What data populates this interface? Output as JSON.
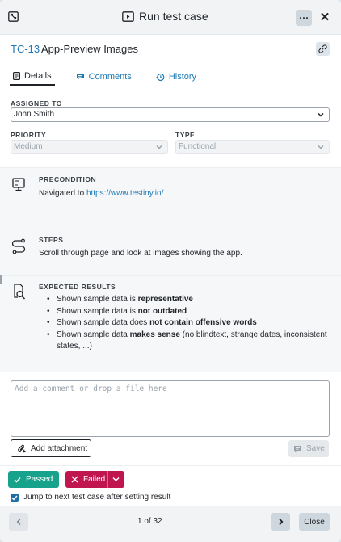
{
  "header": {
    "title": "Run test case",
    "more_label": "⋯",
    "close_label": "✕"
  },
  "case": {
    "id": "TC-13",
    "name": "App-Preview Images"
  },
  "tabs": [
    {
      "label": "Details",
      "icon": "document-icon"
    },
    {
      "label": "Comments",
      "icon": "comment-icon"
    },
    {
      "label": "History",
      "icon": "history-icon"
    }
  ],
  "assigned_to": {
    "label": "ASSIGNED TO",
    "value": "John Smith"
  },
  "priority": {
    "label": "PRIORITY",
    "value": "Medium"
  },
  "type": {
    "label": "TYPE",
    "value": "Functional"
  },
  "precondition": {
    "label": "PRECONDITION",
    "text": "Navigated to ",
    "link": "https://www.testiny.io/"
  },
  "steps": {
    "label": "STEPS",
    "text": "Scroll through page and look at images showing the app."
  },
  "expected": {
    "label": "EXPECTED RESULTS",
    "items": [
      {
        "pre": "Shown sample data is ",
        "bold": "representative",
        "post": ""
      },
      {
        "pre": "Shown sample data is ",
        "bold": "not outdated",
        "post": ""
      },
      {
        "pre": "Shown sample data does ",
        "bold": "not contain offensive words",
        "post": ""
      },
      {
        "pre": "Shown sample data ",
        "bold": "makes sense",
        "post": " (no blindtext, strange dates, inconsistent states, ...)"
      }
    ]
  },
  "comment": {
    "placeholder": "Add a comment or drop a file here"
  },
  "attachment_label": "Add attachment",
  "save_label": "Save",
  "result": {
    "passed_label": "Passed",
    "failed_label": "Failed",
    "jump_label": "Jump to next test case after setting result",
    "jump_checked": true
  },
  "pager": {
    "text": "1 of 32",
    "close_label": "Close"
  },
  "colors": {
    "accent": "#1e7ab3",
    "passed": "#17a28b",
    "failed": "#c1154f"
  }
}
